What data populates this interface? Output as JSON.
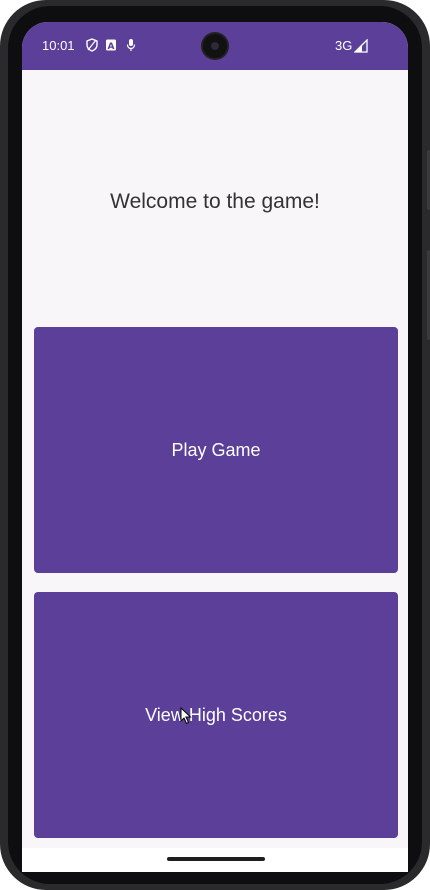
{
  "status_bar": {
    "time": "10:01",
    "network": "3G",
    "icons": [
      "shield-icon",
      "font-a-icon",
      "mic-icon",
      "signal-icon"
    ],
    "color": "#5b3f99"
  },
  "main": {
    "welcome_text": "Welcome to the game!",
    "play_button_label": "Play Game",
    "high_scores_button_label": "View High Scores"
  },
  "colors": {
    "accent": "#5b3f99",
    "background": "#f8f6f9",
    "button_text": "#ffffff"
  }
}
